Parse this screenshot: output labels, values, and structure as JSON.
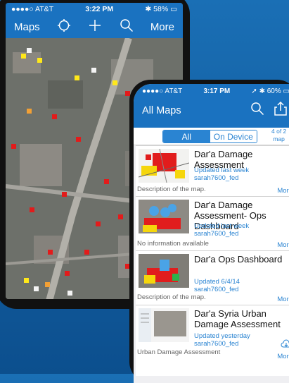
{
  "map_phone": {
    "status": {
      "carrier": "●●●●○ AT&T",
      "time": "3:22 PM",
      "battery": "58%"
    },
    "nav": {
      "maps_label": "Maps",
      "more_label": "More"
    }
  },
  "list_phone": {
    "status": {
      "carrier": "●●●●○ AT&T",
      "time": "3:17 PM",
      "battery": "60%"
    },
    "title": "All Maps",
    "segments": {
      "all": "All",
      "on_device": "On Device"
    },
    "count_line1": "4 of 2",
    "count_line2": "map",
    "items": [
      {
        "title": "Dar'a Damage Assessment",
        "updated": "Updated last week",
        "owner": "sarah7600_fed",
        "desc": "Description of the map.",
        "more": "More"
      },
      {
        "title": "Dar'a Damage Assessment- Ops Dashboard",
        "updated": "Updated last week",
        "owner": "sarah7600_fed",
        "desc": "No information available",
        "more": "More"
      },
      {
        "title": "Dar'a Ops Dashboard",
        "updated": "Updated 6/4/14",
        "owner": "sarah7600_fed",
        "desc": "Description of the map.",
        "more": "More"
      },
      {
        "title": "Dar'a Syria Urban Damage Assessment",
        "updated": "Updated yesterday",
        "owner": "sarah7600_fed",
        "desc": "Urban Damage Assessment",
        "more": "More"
      }
    ]
  },
  "colors": {
    "blue_bar": "#1a72c0",
    "accent": "#2a84d2",
    "marker_red": "#e21b1b",
    "marker_yellow": "#ffe81a"
  }
}
